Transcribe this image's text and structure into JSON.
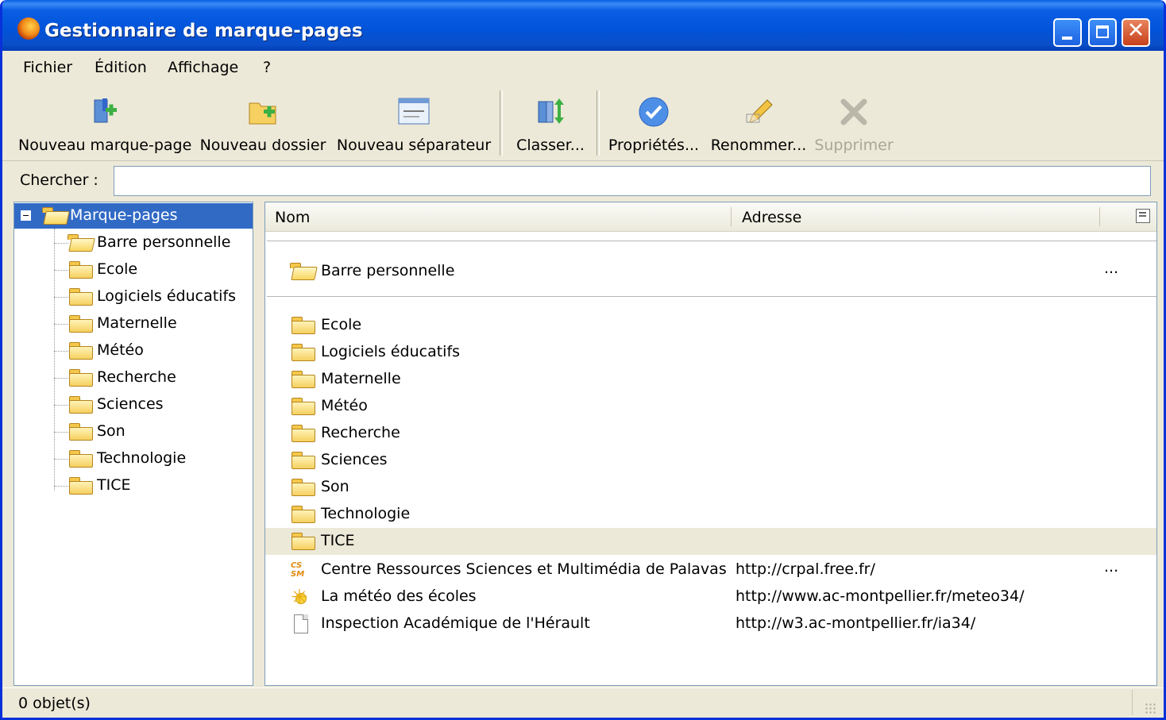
{
  "window": {
    "title": "Gestionnaire de marque-pages"
  },
  "menu": [
    {
      "label": "Fichier"
    },
    {
      "label": "Édition"
    },
    {
      "label": "Affichage"
    },
    {
      "label": "?"
    }
  ],
  "toolbar": {
    "new_bookmark": "Nouveau marque-page",
    "new_folder": "Nouveau dossier",
    "new_separator": "Nouveau séparateur",
    "sort": "Classer...",
    "properties": "Propriétés...",
    "rename": "Renommer...",
    "delete": "Supprimer"
  },
  "search": {
    "label": "Chercher :",
    "value": ""
  },
  "tree": {
    "root": "Marque-pages",
    "items": [
      "Barre personnelle",
      "Ecole",
      "Logiciels éducatifs",
      "Maternelle",
      "Météo",
      "Recherche",
      "Sciences",
      "Son",
      "Technologie",
      "TICE"
    ]
  },
  "list": {
    "columns": {
      "name": "Nom",
      "address": "Adresse"
    },
    "top_folder": {
      "name": "Barre personnelle",
      "more": "..."
    },
    "folders": [
      "Ecole",
      "Logiciels éducatifs",
      "Maternelle",
      "Météo",
      "Recherche",
      "Sciences",
      "Son",
      "Technologie",
      "TICE"
    ],
    "selected_folder": "TICE",
    "bookmarks": [
      {
        "name": "Centre Ressources Sciences et Multimédia de Palavas",
        "address": "http://crpal.free.fr/",
        "more": "...",
        "icon": "csm-icon"
      },
      {
        "name": "La météo des écoles",
        "address": "http://www.ac-montpellier.fr/meteo34/",
        "more": "",
        "icon": "sun-icon"
      },
      {
        "name": "Inspection Académique de l'Hérault",
        "address": "http://w3.ac-montpellier.fr/ia34/",
        "more": "",
        "icon": "page-icon"
      }
    ]
  },
  "status": {
    "text": "0 objet(s)"
  },
  "colors": {
    "title_bar": "#0a5fe5",
    "selection": "#316ac5",
    "chrome": "#ece9d8"
  }
}
